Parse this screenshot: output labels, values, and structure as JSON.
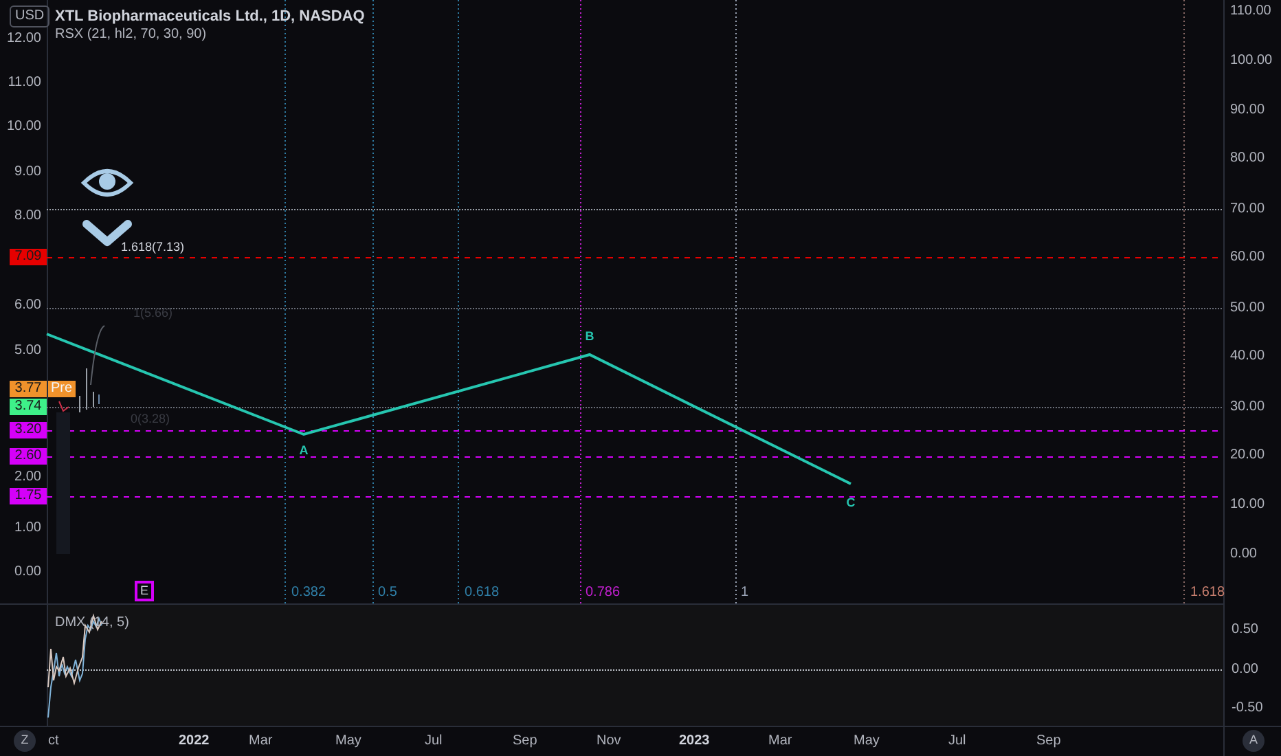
{
  "header": {
    "currency": "USD",
    "title": "XTL Biopharmaceuticals Ltd., 1D, NASDAQ",
    "indicator": "RSX (21, hl2, 70, 30, 90)"
  },
  "price_axis": [
    "12.00",
    "11.00",
    "10.00",
    "9.00",
    "8.00",
    "6.00",
    "5.00",
    "2.00",
    "1.00",
    "0.00"
  ],
  "price_tags": [
    {
      "text": "7.09",
      "color": "#e60000"
    },
    {
      "text": "3.77",
      "color": "#f0922b",
      "badge": "Pre"
    },
    {
      "text": "3.74",
      "color": "#3ef089"
    },
    {
      "text": "3.20",
      "color": "#d500f9"
    },
    {
      "text": "2.60",
      "color": "#d500f9"
    },
    {
      "text": "1.75",
      "color": "#d500f9"
    }
  ],
  "rsx_axis": [
    "110.00",
    "100.00",
    "90.00",
    "80.00",
    "70.00",
    "60.00",
    "50.00",
    "40.00",
    "30.00",
    "20.00",
    "10.00",
    "0.00"
  ],
  "fib_price_labels": [
    "1.618(7.13)",
    "1(5.66)",
    "0(3.28)"
  ],
  "wave_labels": [
    "A",
    "B",
    "C"
  ],
  "fib_time_labels": [
    {
      "text": "0.382",
      "color": "#2f7ea6"
    },
    {
      "text": "0.5",
      "color": "#2f7ea6"
    },
    {
      "text": "0.618",
      "color": "#2f7ea6"
    },
    {
      "text": "0.786",
      "color": "#c21fcf"
    },
    {
      "text": "1",
      "color": "#9aa3b5"
    },
    {
      "text": "1.618",
      "color": "#c77e6e"
    }
  ],
  "earnings_marker": "E",
  "dmx": {
    "label": "DMX (14, 5)",
    "axis": [
      "0.50",
      "0.00",
      "-0.50"
    ]
  },
  "time_axis": [
    {
      "text": "ct",
      "kind": "month"
    },
    {
      "text": "2022",
      "kind": "year"
    },
    {
      "text": "Mar",
      "kind": "month"
    },
    {
      "text": "May",
      "kind": "month"
    },
    {
      "text": "Jul",
      "kind": "month"
    },
    {
      "text": "Sep",
      "kind": "month"
    },
    {
      "text": "Nov",
      "kind": "month"
    },
    {
      "text": "2023",
      "kind": "year"
    },
    {
      "text": "Mar",
      "kind": "month"
    },
    {
      "text": "May",
      "kind": "month"
    },
    {
      "text": "Jul",
      "kind": "month"
    },
    {
      "text": "Sep",
      "kind": "month"
    }
  ],
  "buttons": [
    "Z",
    "A"
  ]
}
